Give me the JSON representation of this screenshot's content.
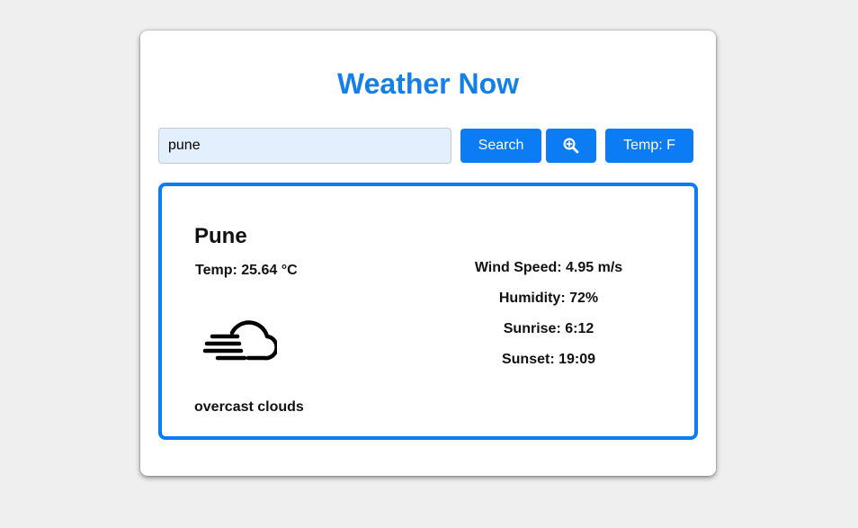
{
  "app": {
    "title": "Weather Now",
    "accent_color": "#0b7cf4",
    "title_color": "#1380ea"
  },
  "search": {
    "value": "pune",
    "search_label": "Search",
    "locate_icon": "zoom-in-icon",
    "unit_toggle_label": "Temp: F"
  },
  "weather": {
    "city": "Pune",
    "temperature": "Temp: 25.64 °C",
    "icon": "cloud-wind-icon",
    "description": "overcast clouds",
    "wind_speed": "Wind Speed: 4.95 m/s",
    "humidity": "Humidity: 72%",
    "sunrise": "Sunrise: 6:12",
    "sunset": "Sunset: 19:09"
  }
}
